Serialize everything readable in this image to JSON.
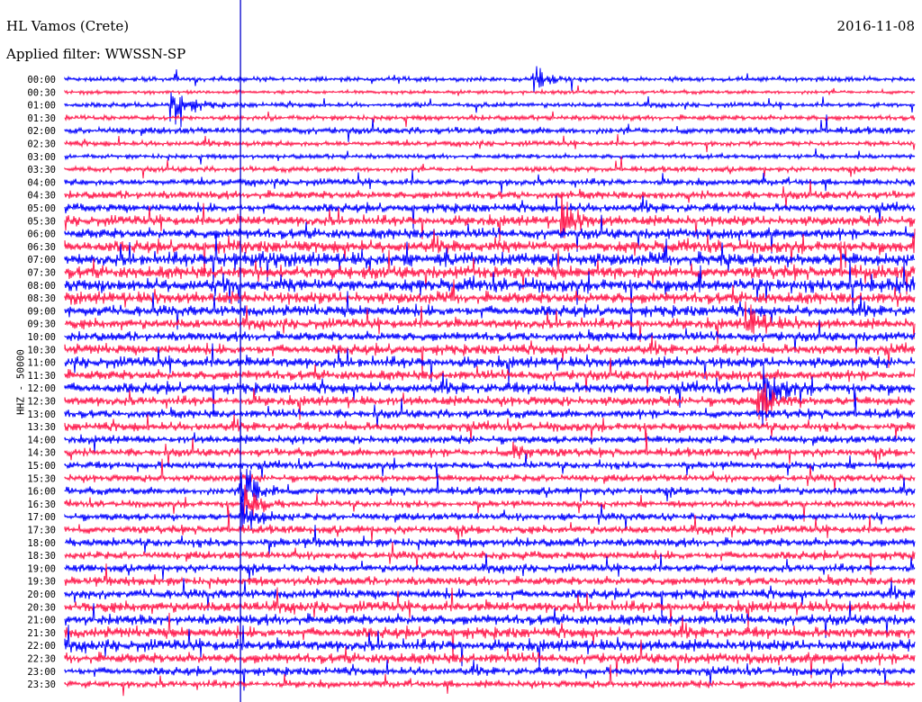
{
  "header": {
    "station": "HL Vamos (Crete)",
    "filter": "Applied filter: WWSSN-SP",
    "date": "2016-11-08"
  },
  "chart_data": {
    "type": "line",
    "subtype": "helicorder",
    "title": "HL Vamos (Crete)",
    "ylabel": "HHZ - 50000",
    "row_minutes": 30,
    "colors": [
      "#0000ff",
      "#ff1a4d"
    ],
    "marker_color": "#0000cc",
    "marker_minute": 6.2,
    "rows": [
      {
        "label": "00:00",
        "level": 0.15
      },
      {
        "label": "00:30",
        "level": 0.08
      },
      {
        "label": "01:00",
        "level": 0.15
      },
      {
        "label": "01:30",
        "level": 0.2
      },
      {
        "label": "02:00",
        "level": 0.3
      },
      {
        "label": "02:30",
        "level": 0.2
      },
      {
        "label": "03:00",
        "level": 0.15
      },
      {
        "label": "03:30",
        "level": 0.2
      },
      {
        "label": "04:00",
        "level": 0.3
      },
      {
        "label": "04:30",
        "level": 0.4
      },
      {
        "label": "05:00",
        "level": 0.45
      },
      {
        "label": "05:30",
        "level": 0.55
      },
      {
        "label": "06:00",
        "level": 0.6
      },
      {
        "label": "06:30",
        "level": 0.7
      },
      {
        "label": "07:00",
        "level": 0.8
      },
      {
        "label": "07:30",
        "level": 0.75
      },
      {
        "label": "08:00",
        "level": 0.8
      },
      {
        "label": "08:30",
        "level": 0.7
      },
      {
        "label": "09:00",
        "level": 0.6
      },
      {
        "label": "09:30",
        "level": 0.55
      },
      {
        "label": "10:00",
        "level": 0.5
      },
      {
        "label": "10:30",
        "level": 0.55
      },
      {
        "label": "11:00",
        "level": 0.6
      },
      {
        "label": "11:30",
        "level": 0.55
      },
      {
        "label": "12:00",
        "level": 0.6
      },
      {
        "label": "12:30",
        "level": 0.5
      },
      {
        "label": "13:00",
        "level": 0.45
      },
      {
        "label": "13:30",
        "level": 0.45
      },
      {
        "label": "14:00",
        "level": 0.4
      },
      {
        "label": "14:30",
        "level": 0.4
      },
      {
        "label": "15:00",
        "level": 0.35
      },
      {
        "label": "15:30",
        "level": 0.35
      },
      {
        "label": "16:00",
        "level": 0.35
      },
      {
        "label": "16:30",
        "level": 0.3
      },
      {
        "label": "17:00",
        "level": 0.35
      },
      {
        "label": "17:30",
        "level": 0.4
      },
      {
        "label": "18:00",
        "level": 0.45
      },
      {
        "label": "18:30",
        "level": 0.4
      },
      {
        "label": "19:00",
        "level": 0.4
      },
      {
        "label": "19:30",
        "level": 0.45
      },
      {
        "label": "20:00",
        "level": 0.5
      },
      {
        "label": "20:30",
        "level": 0.6
      },
      {
        "label": "21:00",
        "level": 0.6
      },
      {
        "label": "21:30",
        "level": 0.6
      },
      {
        "label": "22:00",
        "level": 0.65
      },
      {
        "label": "22:30",
        "level": 0.6
      },
      {
        "label": "23:00",
        "level": 0.4
      },
      {
        "label": "23:30",
        "level": 0.35
      }
    ],
    "events": [
      {
        "row": 0,
        "minute": 16.5,
        "amp": 2
      },
      {
        "row": 2,
        "minute": 3.7,
        "amp": 3.5
      },
      {
        "row": 11,
        "minute": 17.5,
        "amp": 3
      },
      {
        "row": 19,
        "minute": 24.0,
        "amp": 3
      },
      {
        "row": 24,
        "minute": 24.6,
        "amp": 4
      },
      {
        "row": 25,
        "minute": 24.4,
        "amp": 4
      },
      {
        "row": 29,
        "minute": 15.8,
        "amp": 2
      },
      {
        "row": 32,
        "minute": 6.2,
        "amp": 6
      },
      {
        "row": 33,
        "minute": 6.2,
        "amp": 4
      },
      {
        "row": 34,
        "minute": 6.2,
        "amp": 3
      }
    ]
  }
}
